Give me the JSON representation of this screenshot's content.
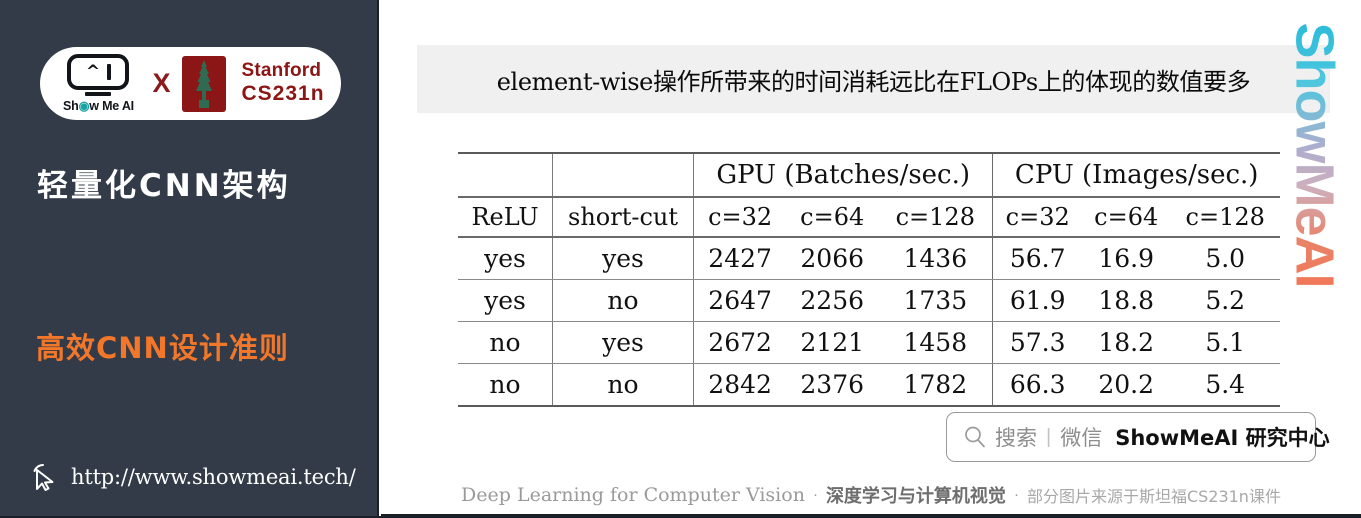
{
  "sidebar": {
    "badge": {
      "brand_name": "Show Me AI",
      "cross": "X",
      "partner_line1": "Stanford",
      "partner_line2": "CS231n",
      "brand_color": "#111418",
      "partner_color": "#8C1515"
    },
    "title": "轻量化CNN架构",
    "subtitle": "高效CNN设计准则",
    "subtitle_color": "#F2772A",
    "url": "http://www.showmeai.tech/",
    "cursor_icon": "pointer-cursor-icon",
    "background_color": "#323b47"
  },
  "banner": {
    "text": "element-wise操作所带来的时间消耗远比在FLOPs上的体现的数值要多",
    "background_color": "#f0f0f0"
  },
  "table": {
    "group_headers": {
      "blank1": "",
      "blank2": "",
      "gpu": "GPU (Batches/sec.)",
      "cpu": "CPU (Images/sec.)"
    },
    "column_headers": {
      "relu": "ReLU",
      "shortcut": "short-cut",
      "gpu_c32": "c=32",
      "gpu_c64": "c=64",
      "gpu_c128": "c=128",
      "cpu_c32": "c=32",
      "cpu_c64": "c=64",
      "cpu_c128": "c=128"
    },
    "rows": [
      {
        "relu": "yes",
        "shortcut": "yes",
        "gpu_c32": "2427",
        "gpu_c64": "2066",
        "gpu_c128": "1436",
        "cpu_c32": "56.7",
        "cpu_c64": "16.9",
        "cpu_c128": "5.0"
      },
      {
        "relu": "yes",
        "shortcut": "no",
        "gpu_c32": "2647",
        "gpu_c64": "2256",
        "gpu_c128": "1735",
        "cpu_c32": "61.9",
        "cpu_c64": "18.8",
        "cpu_c128": "5.2"
      },
      {
        "relu": "no",
        "shortcut": "yes",
        "gpu_c32": "2672",
        "gpu_c64": "2121",
        "gpu_c128": "1458",
        "cpu_c32": "57.3",
        "cpu_c64": "18.2",
        "cpu_c128": "5.1"
      },
      {
        "relu": "no",
        "shortcut": "no",
        "gpu_c32": "2842",
        "gpu_c64": "2376",
        "gpu_c128": "1782",
        "cpu_c32": "66.3",
        "cpu_c64": "20.2",
        "cpu_c128": "5.4"
      }
    ]
  },
  "search_pill": {
    "icon": "magnifier-icon",
    "search_label": "搜索",
    "divider": "|",
    "channel_label": "微信",
    "account_name": "ShowMeAI 研究中心"
  },
  "footer": {
    "course_en": "Deep Learning for Computer Vision",
    "dot1": "·",
    "course_cn": "深度学习与计算机视觉",
    "dot2": "·",
    "credit": "部分图片来源于斯坦福CS231n课件"
  },
  "watermark": {
    "text": "ShowMeAI"
  }
}
